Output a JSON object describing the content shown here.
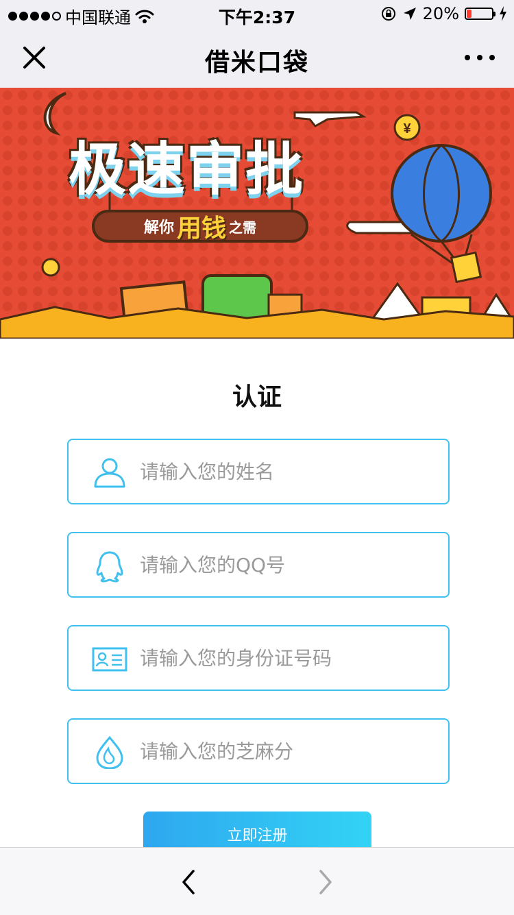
{
  "status_bar": {
    "carrier": "中国联通",
    "time": "下午2:37",
    "battery_percent": "20%",
    "battery_level": 0.2,
    "icons": [
      "signal-dots-icon",
      "wifi-icon",
      "rotation-lock-icon",
      "location-arrow-icon",
      "battery-icon",
      "charging-bolt-icon"
    ]
  },
  "nav": {
    "title": "借米口袋",
    "close_icon": "close-icon",
    "more_icon": "more-dots-icon"
  },
  "banner": {
    "title": "极速审批",
    "subtitle_part1": "解你",
    "subtitle_part2": "用钱",
    "subtitle_part3": "之需",
    "colors": {
      "background": "#e64c35",
      "accent": "#ffd23a",
      "outline": "#4a2a12"
    }
  },
  "form": {
    "heading": "认证",
    "fields": [
      {
        "icon": "user-icon",
        "placeholder": "请输入您的姓名",
        "value": ""
      },
      {
        "icon": "qq-penguin-icon",
        "placeholder": "请输入您的QQ号",
        "value": ""
      },
      {
        "icon": "id-card-icon",
        "placeholder": "请输入您的身份证号码",
        "value": ""
      },
      {
        "icon": "sesame-drop-icon",
        "placeholder": "请输入您的芝麻分",
        "value": ""
      }
    ],
    "submit_label": "立即注册",
    "border_color": "#3fc0ef"
  },
  "toolbar": {
    "back_icon": "chevron-left-icon",
    "forward_icon": "chevron-right-icon"
  }
}
